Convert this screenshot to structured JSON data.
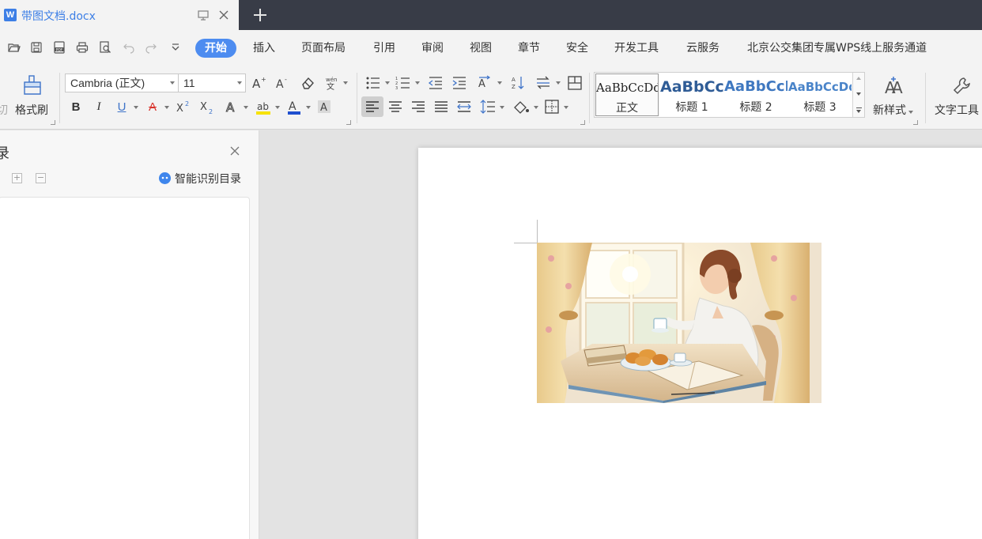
{
  "tab": {
    "app_badge": "W",
    "title": "带图文档.docx"
  },
  "menu": {
    "items": [
      "开始",
      "插入",
      "页面布局",
      "引用",
      "审阅",
      "视图",
      "章节",
      "安全",
      "开发工具",
      "云服务",
      "北京公交集团专属WPS线上服务通道"
    ],
    "active": "开始"
  },
  "ribbon": {
    "clipboard": {
      "cut_label": "切",
      "format_painter_label": "格式刷"
    },
    "font": {
      "name": "Cambria (正文)",
      "size": "11"
    },
    "styles": [
      {
        "sample": "AaBbCcDd",
        "name": "正文",
        "color": "#222222"
      },
      {
        "sample": "AaBbCcI",
        "name": "标题 1",
        "color": "#2f5c96"
      },
      {
        "sample": "AaBbCcD",
        "name": "标题 2",
        "color": "#3f78c0"
      },
      {
        "sample": "AaBbCcDd",
        "name": "标题 3",
        "color": "#4a84c9"
      }
    ],
    "new_style_label": "新样式",
    "text_tools_label": "文字工具"
  },
  "nav_pane": {
    "title": "录",
    "smart_toc_label": "智能识别目录"
  },
  "colors": {
    "accent": "#4d8cf0",
    "titlebar": "#383c47",
    "highlight_yellow": "#f7e200",
    "font_color_blue": "#1f4fcf",
    "font_color_red": "#d9322a"
  }
}
